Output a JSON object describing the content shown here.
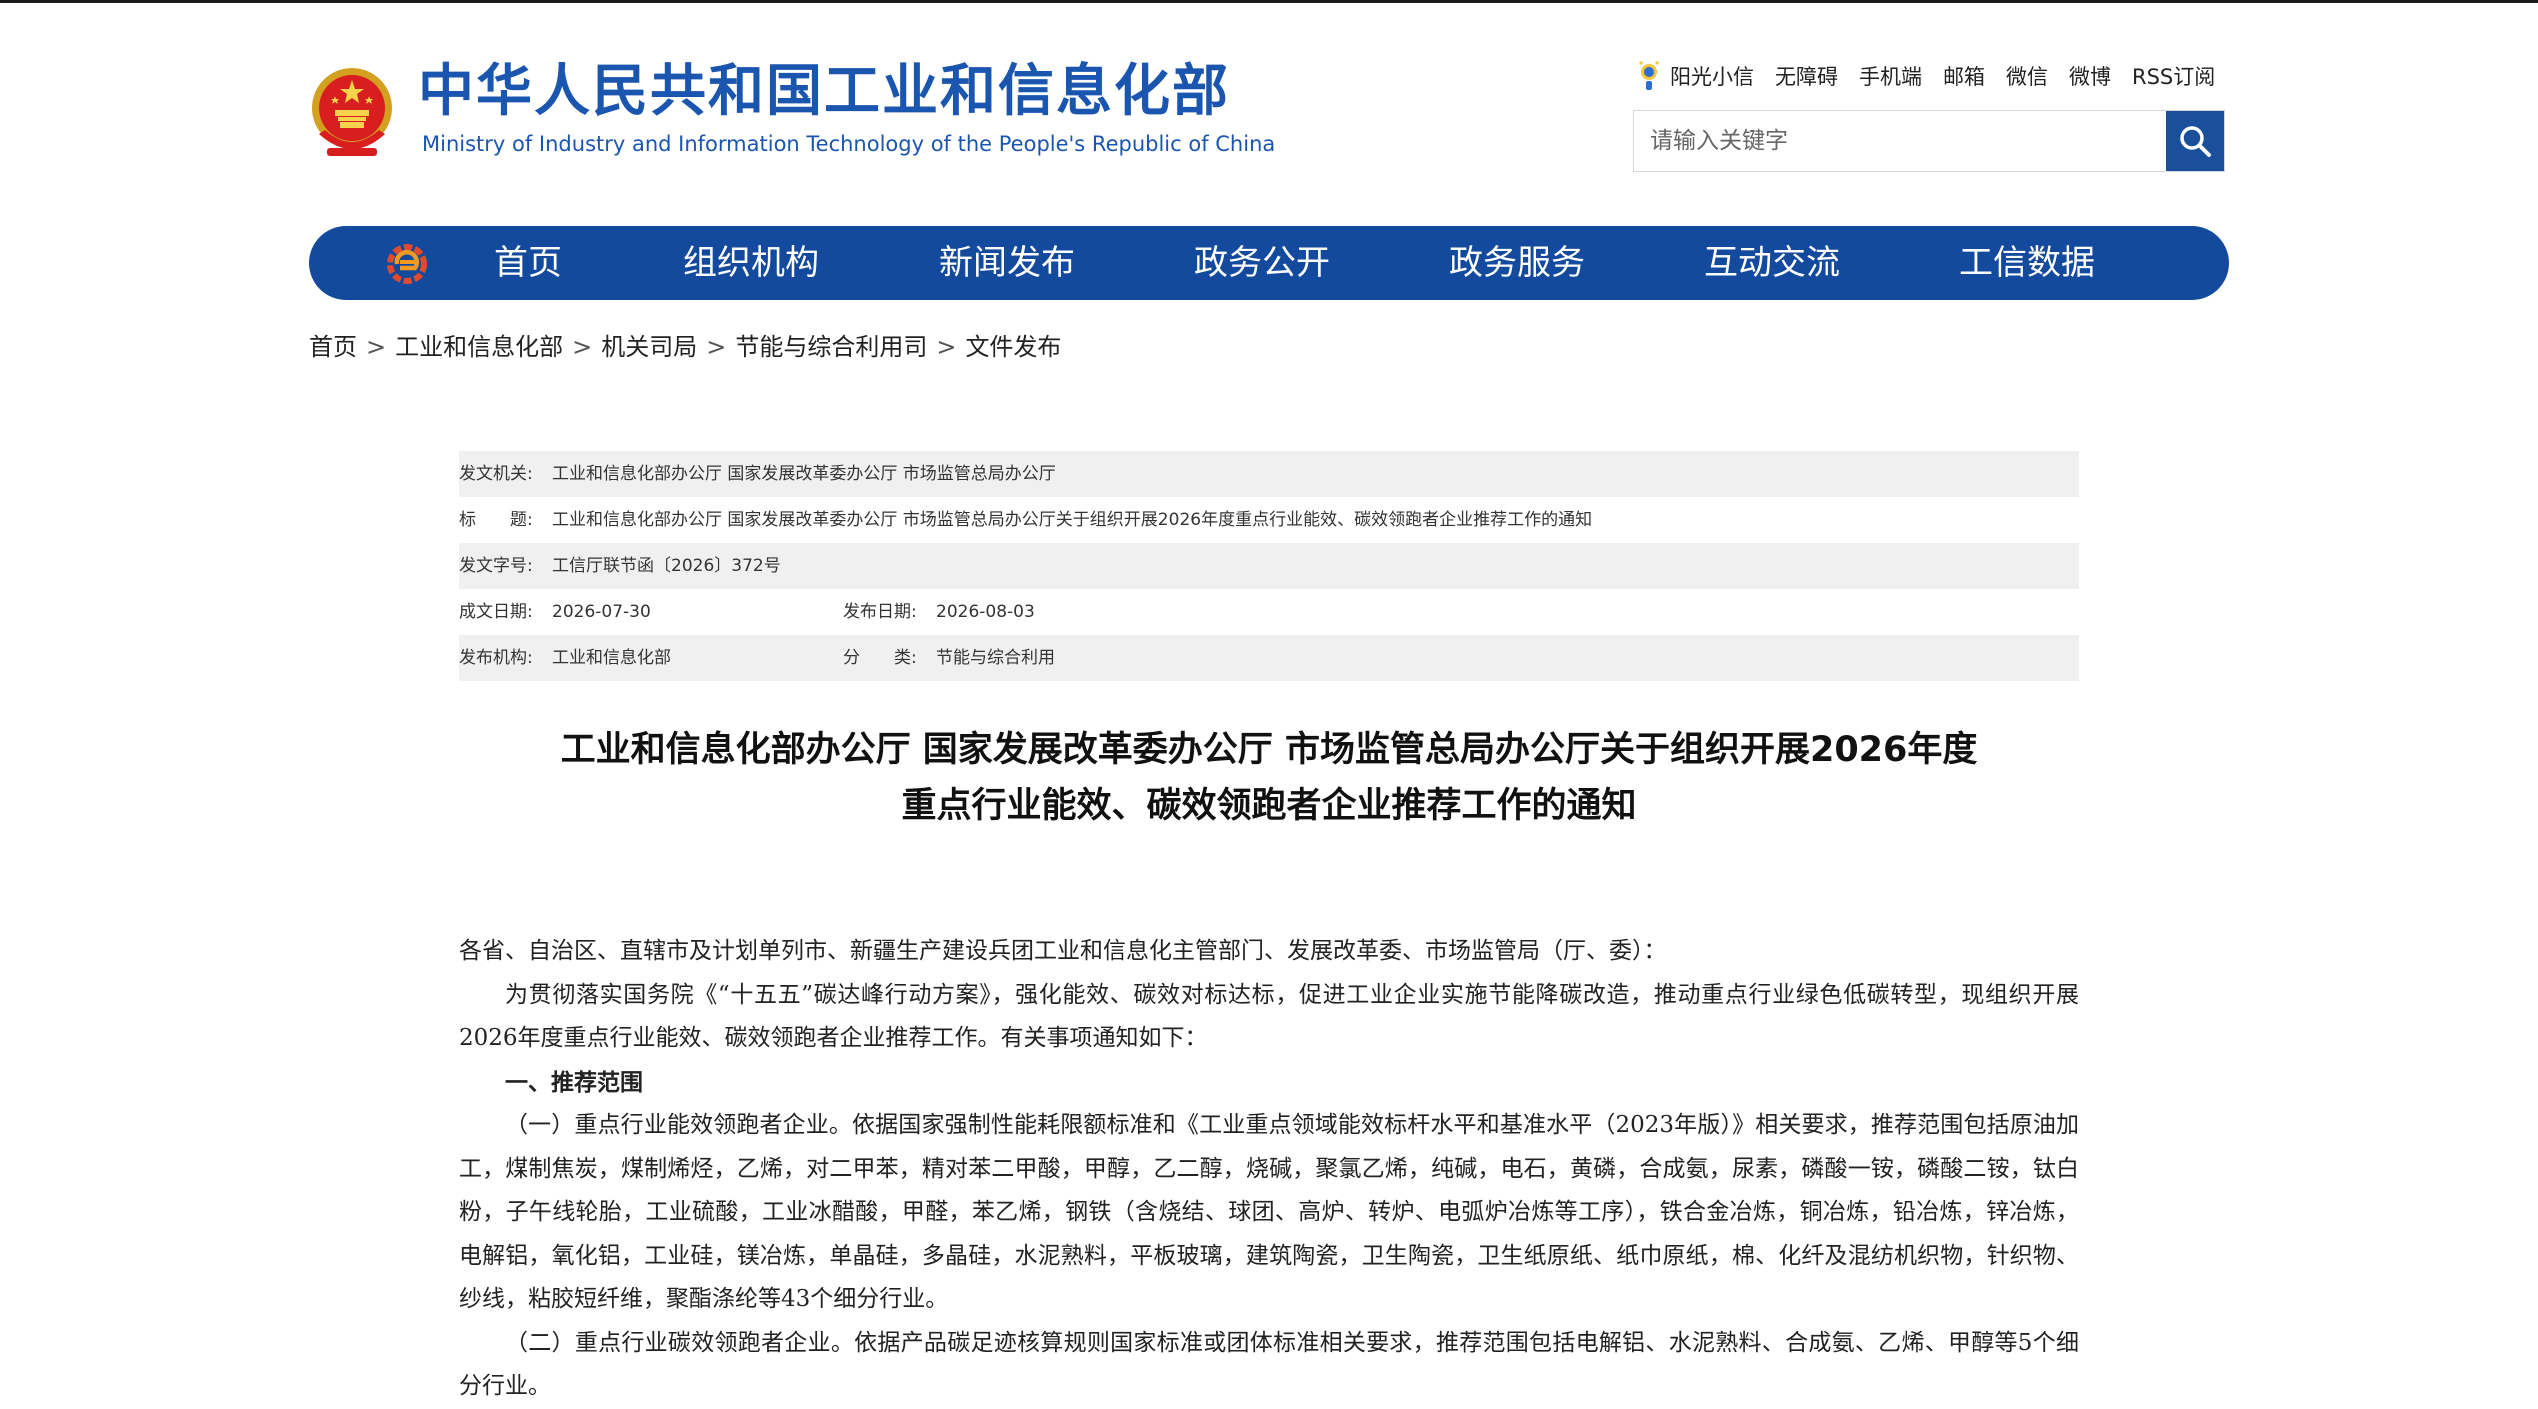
{
  "header": {
    "title_cn": "中华人民共和国工业和信息化部",
    "title_en": "Ministry of Industry and Information Technology of the People's Republic of China",
    "util_links": [
      "阳光小信",
      "无障碍",
      "手机端",
      "邮箱",
      "微信",
      "微博",
      "RSS订阅"
    ],
    "search_placeholder": "请输入关键字"
  },
  "nav": {
    "items": [
      "首页",
      "组织机构",
      "新闻发布",
      "政务公开",
      "政务服务",
      "互动交流",
      "工信数据"
    ]
  },
  "breadcrumb": [
    "首页",
    "工业和信息化部",
    "机关司局",
    "节能与综合利用司",
    "文件发布"
  ],
  "meta": {
    "issuer_label": "发文机关:",
    "issuer": "工业和信息化部办公厅 国家发展改革委办公厅 市场监管总局办公厅",
    "title_label": "标　　题:",
    "title": "工业和信息化部办公厅 国家发展改革委办公厅 市场监管总局办公厅关于组织开展2026年度重点行业能效、碳效领跑者企业推荐工作的通知",
    "doc_no_label": "发文字号:",
    "doc_no": "工信厅联节函〔2026〕372号",
    "written_label": "成文日期:",
    "written_date": "2026-07-30",
    "published_label": "发布日期:",
    "published_date": "2026-08-03",
    "org_label": "发布机构:",
    "org": "工业和信息化部",
    "category_label": "分　　类:",
    "category": "节能与综合利用"
  },
  "document": {
    "title_line1": "工业和信息化部办公厅 国家发展改革委办公厅 市场监管总局办公厅关于组织开展2026年度",
    "title_line2": "重点行业能效、碳效领跑者企业推荐工作的通知",
    "salutation": "各省、自治区、直辖市及计划单列市、新疆生产建设兵团工业和信息化主管部门、发展改革委、市场监管局（厅、委）：",
    "intro": "为贯彻落实国务院《“十五五”碳达峰行动方案》，强化能效、碳效对标达标，促进工业企业实施节能降碳改造，推动重点行业绿色低碳转型，现组织开展2026年度重点行业能效、碳效领跑者企业推荐工作。有关事项通知如下：",
    "section1": "一、推荐范围",
    "item1": "（一）重点行业能效领跑者企业。依据国家强制性能耗限额标准和《工业重点领域能效标杆水平和基准水平（2023年版）》相关要求，推荐范围包括原油加工，煤制焦炭，煤制烯烃，乙烯，对二甲苯，精对苯二甲酸，甲醇，乙二醇，烧碱，聚氯乙烯，纯碱，电石，黄磷，合成氨，尿素，磷酸一铵，磷酸二铵，钛白粉，子午线轮胎，工业硫酸，工业冰醋酸，甲醛，苯乙烯，钢铁（含烧结、球团、高炉、转炉、电弧炉冶炼等工序），铁合金冶炼，铜冶炼，铅冶炼，锌冶炼，电解铝，氧化铝，工业硅，镁冶炼，单晶硅，多晶硅，水泥熟料，平板玻璃，建筑陶瓷，卫生陶瓷，卫生纸原纸、纸巾原纸，棉、化纤及混纺机织物，针织物、纱线，粘胶短纤维，聚酯涤纶等43个细分行业。",
    "item2": "（二）重点行业碳效领跑者企业。依据产品碳足迹核算规则国家标准或团体标准相关要求，推荐范围包括电解铝、水泥熟料、合成氨、乙烯、甲醇等5个细分行业。"
  },
  "colors": {
    "brand_blue": "#1a56b0",
    "nav_blue": "#144a9d",
    "meta_shade": "#f0f0f0"
  },
  "icons": [
    "national-emblem-icon",
    "sun-mascot-icon",
    "search-icon",
    "nav-logo-icon"
  ]
}
